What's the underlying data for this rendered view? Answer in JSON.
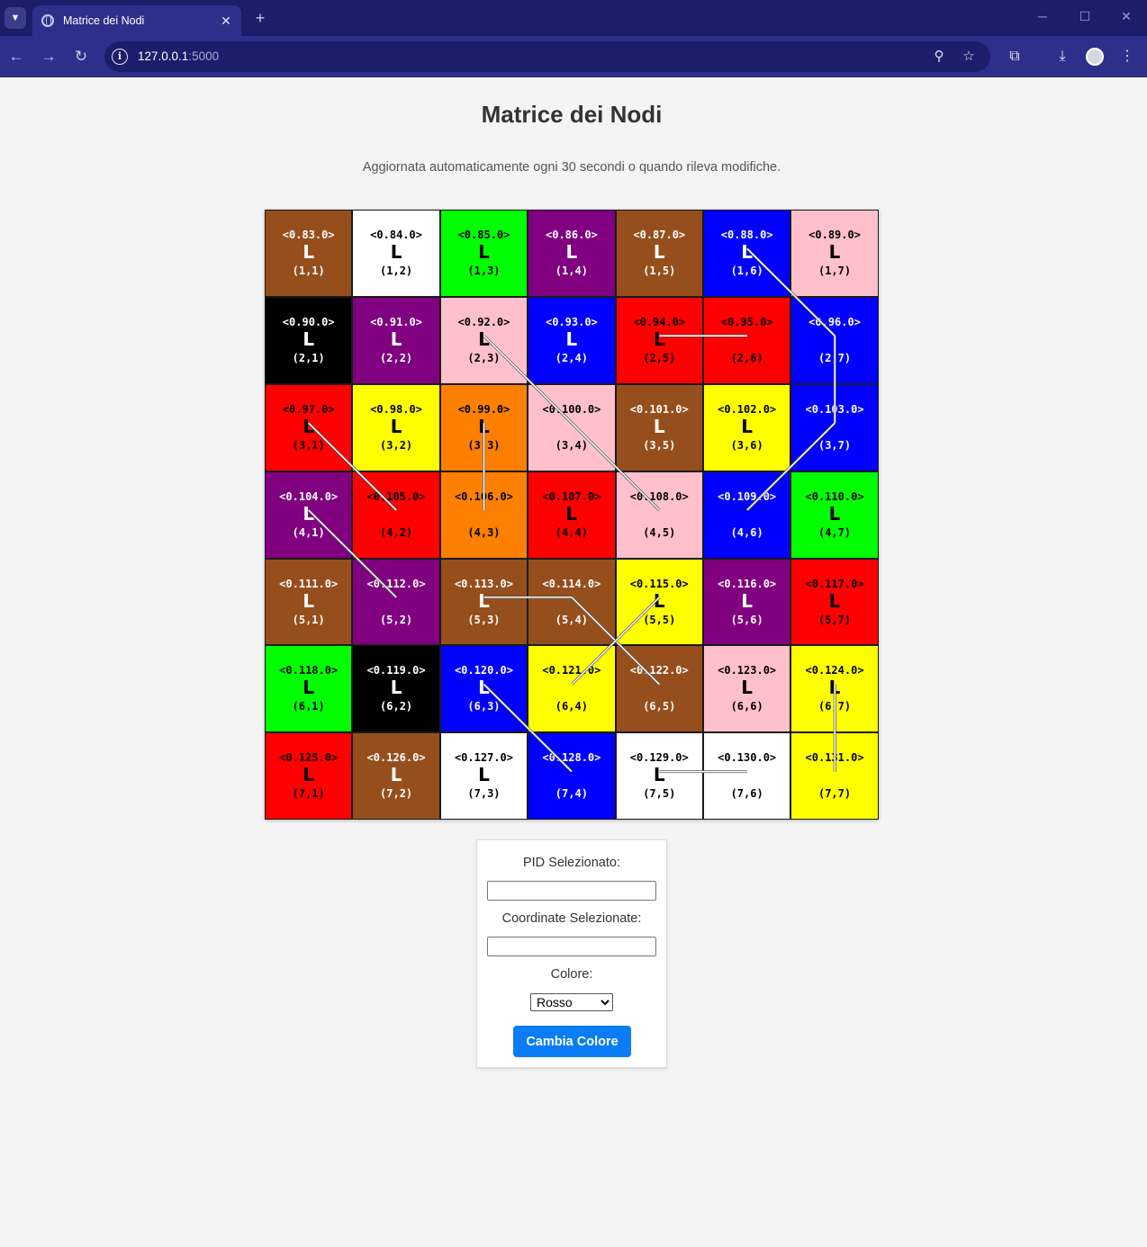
{
  "browser": {
    "tab_title": "Matrice dei Nodi",
    "url_host": "127.0.0.1",
    "url_port": ":5000"
  },
  "page": {
    "title": "Matrice dei Nodi",
    "subtitle": "Aggiornata automaticamente ogni 30 secondi o quando rileva modifiche."
  },
  "matrix": {
    "cells": [
      {
        "pid": "<0.83.0>",
        "letter": "L",
        "coord": "(1,1)",
        "color": "#964f1c",
        "text": "#ffffff"
      },
      {
        "pid": "<0.84.0>",
        "letter": "L",
        "coord": "(1,2)",
        "color": "#ffffff",
        "text": "#000000"
      },
      {
        "pid": "<0.85.0>",
        "letter": "L",
        "coord": "(1,3)",
        "color": "#00ff00",
        "text": "#000000"
      },
      {
        "pid": "<0.86.0>",
        "letter": "L",
        "coord": "(1,4)",
        "color": "#800080",
        "text": "#ffffff"
      },
      {
        "pid": "<0.87.0>",
        "letter": "L",
        "coord": "(1,5)",
        "color": "#964f1c",
        "text": "#ffffff"
      },
      {
        "pid": "<0.88.0>",
        "letter": "L",
        "coord": "(1,6)",
        "color": "#0000ff",
        "text": "#ffffff"
      },
      {
        "pid": "<0.89.0>",
        "letter": "L",
        "coord": "(1,7)",
        "color": "#ffc0cb",
        "text": "#000000"
      },
      {
        "pid": "<0.90.0>",
        "letter": "L",
        "coord": "(2,1)",
        "color": "#000000",
        "text": "#ffffff"
      },
      {
        "pid": "<0.91.0>",
        "letter": "L",
        "coord": "(2,2)",
        "color": "#800080",
        "text": "#ffffff"
      },
      {
        "pid": "<0.92.0>",
        "letter": "L",
        "coord": "(2,3)",
        "color": "#ffc0cb",
        "text": "#000000"
      },
      {
        "pid": "<0.93.0>",
        "letter": "L",
        "coord": "(2,4)",
        "color": "#0000ff",
        "text": "#ffffff"
      },
      {
        "pid": "<0.94.0>",
        "letter": "L",
        "coord": "(2,5)",
        "color": "#ff0000",
        "text": "#000000"
      },
      {
        "pid": "<0.95.0>",
        "letter": "",
        "coord": "(2,6)",
        "color": "#ff0000",
        "text": "#000000"
      },
      {
        "pid": "<0.96.0>",
        "letter": "",
        "coord": "(2,7)",
        "color": "#0000ff",
        "text": "#ffffff"
      },
      {
        "pid": "<0.97.0>",
        "letter": "L",
        "coord": "(3,1)",
        "color": "#ff0000",
        "text": "#000000"
      },
      {
        "pid": "<0.98.0>",
        "letter": "L",
        "coord": "(3,2)",
        "color": "#ffff00",
        "text": "#000000"
      },
      {
        "pid": "<0.99.0>",
        "letter": "L",
        "coord": "(3,3)",
        "color": "#ff8000",
        "text": "#000000"
      },
      {
        "pid": "<0.100.0>",
        "letter": "",
        "coord": "(3,4)",
        "color": "#ffc0cb",
        "text": "#000000"
      },
      {
        "pid": "<0.101.0>",
        "letter": "L",
        "coord": "(3,5)",
        "color": "#964f1c",
        "text": "#ffffff"
      },
      {
        "pid": "<0.102.0>",
        "letter": "L",
        "coord": "(3,6)",
        "color": "#ffff00",
        "text": "#000000"
      },
      {
        "pid": "<0.103.0>",
        "letter": "",
        "coord": "(3,7)",
        "color": "#0000ff",
        "text": "#ffffff"
      },
      {
        "pid": "<0.104.0>",
        "letter": "L",
        "coord": "(4,1)",
        "color": "#800080",
        "text": "#ffffff"
      },
      {
        "pid": "<0.105.0>",
        "letter": "",
        "coord": "(4,2)",
        "color": "#ff0000",
        "text": "#000000"
      },
      {
        "pid": "<0.106.0>",
        "letter": "",
        "coord": "(4,3)",
        "color": "#ff8000",
        "text": "#000000"
      },
      {
        "pid": "<0.107.0>",
        "letter": "L",
        "coord": "(4,4)",
        "color": "#ff0000",
        "text": "#000000"
      },
      {
        "pid": "<0.108.0>",
        "letter": "",
        "coord": "(4,5)",
        "color": "#ffc0cb",
        "text": "#000000"
      },
      {
        "pid": "<0.109.0>",
        "letter": "",
        "coord": "(4,6)",
        "color": "#0000ff",
        "text": "#ffffff"
      },
      {
        "pid": "<0.110.0>",
        "letter": "L",
        "coord": "(4,7)",
        "color": "#00ff00",
        "text": "#000000"
      },
      {
        "pid": "<0.111.0>",
        "letter": "L",
        "coord": "(5,1)",
        "color": "#964f1c",
        "text": "#ffffff"
      },
      {
        "pid": "<0.112.0>",
        "letter": "",
        "coord": "(5,2)",
        "color": "#800080",
        "text": "#ffffff"
      },
      {
        "pid": "<0.113.0>",
        "letter": "L",
        "coord": "(5,3)",
        "color": "#964f1c",
        "text": "#ffffff"
      },
      {
        "pid": "<0.114.0>",
        "letter": "",
        "coord": "(5,4)",
        "color": "#964f1c",
        "text": "#ffffff"
      },
      {
        "pid": "<0.115.0>",
        "letter": "L",
        "coord": "(5,5)",
        "color": "#ffff00",
        "text": "#000000"
      },
      {
        "pid": "<0.116.0>",
        "letter": "L",
        "coord": "(5,6)",
        "color": "#800080",
        "text": "#ffffff"
      },
      {
        "pid": "<0.117.0>",
        "letter": "L",
        "coord": "(5,7)",
        "color": "#ff0000",
        "text": "#000000"
      },
      {
        "pid": "<0.118.0>",
        "letter": "L",
        "coord": "(6,1)",
        "color": "#00ff00",
        "text": "#000000"
      },
      {
        "pid": "<0.119.0>",
        "letter": "L",
        "coord": "(6,2)",
        "color": "#000000",
        "text": "#ffffff"
      },
      {
        "pid": "<0.120.0>",
        "letter": "L",
        "coord": "(6,3)",
        "color": "#0000ff",
        "text": "#ffffff"
      },
      {
        "pid": "<0.121.0>",
        "letter": "",
        "coord": "(6,4)",
        "color": "#ffff00",
        "text": "#000000"
      },
      {
        "pid": "<0.122.0>",
        "letter": "",
        "coord": "(6,5)",
        "color": "#964f1c",
        "text": "#ffffff"
      },
      {
        "pid": "<0.123.0>",
        "letter": "L",
        "coord": "(6,6)",
        "color": "#ffc0cb",
        "text": "#000000"
      },
      {
        "pid": "<0.124.0>",
        "letter": "L",
        "coord": "(6,7)",
        "color": "#ffff00",
        "text": "#000000"
      },
      {
        "pid": "<0.125.0>",
        "letter": "L",
        "coord": "(7,1)",
        "color": "#ff0000",
        "text": "#000000"
      },
      {
        "pid": "<0.126.0>",
        "letter": "L",
        "coord": "(7,2)",
        "color": "#964f1c",
        "text": "#ffffff"
      },
      {
        "pid": "<0.127.0>",
        "letter": "L",
        "coord": "(7,3)",
        "color": "#ffffff",
        "text": "#000000"
      },
      {
        "pid": "<0.128.0>",
        "letter": "",
        "coord": "(7,4)",
        "color": "#0000ff",
        "text": "#ffffff"
      },
      {
        "pid": "<0.129.0>",
        "letter": "L",
        "coord": "(7,5)",
        "color": "#ffffff",
        "text": "#000000"
      },
      {
        "pid": "<0.130.0>",
        "letter": "",
        "coord": "(7,6)",
        "color": "#ffffff",
        "text": "#000000"
      },
      {
        "pid": "<0.131.0>",
        "letter": "",
        "coord": "(7,7)",
        "color": "#ffff00",
        "text": "#000000"
      }
    ],
    "links": [
      {
        "from": [
          1,
          6
        ],
        "to": [
          2,
          7
        ]
      },
      {
        "from": [
          2,
          7
        ],
        "to": [
          3,
          7
        ]
      },
      {
        "from": [
          3,
          7
        ],
        "to": [
          4,
          6
        ]
      },
      {
        "from": [
          2,
          5
        ],
        "to": [
          2,
          6
        ]
      },
      {
        "from": [
          2,
          3
        ],
        "to": [
          3,
          4
        ]
      },
      {
        "from": [
          3,
          4
        ],
        "to": [
          4,
          5
        ]
      },
      {
        "from": [
          3,
          1
        ],
        "to": [
          4,
          2
        ]
      },
      {
        "from": [
          3,
          3
        ],
        "to": [
          4,
          3
        ]
      },
      {
        "from": [
          4,
          1
        ],
        "to": [
          5,
          2
        ]
      },
      {
        "from": [
          5,
          3
        ],
        "to": [
          5,
          4
        ]
      },
      {
        "from": [
          5,
          4
        ],
        "to": [
          6,
          5
        ]
      },
      {
        "from": [
          5,
          5
        ],
        "to": [
          6,
          4
        ]
      },
      {
        "from": [
          6,
          3
        ],
        "to": [
          7,
          4
        ]
      },
      {
        "from": [
          6,
          7
        ],
        "to": [
          7,
          7
        ]
      },
      {
        "from": [
          7,
          5
        ],
        "to": [
          7,
          6
        ]
      }
    ]
  },
  "panel": {
    "pid_label": "PID Selezionato:",
    "pid_value": "",
    "coord_label": "Coordinate Selezionate:",
    "coord_value": "",
    "color_label": "Colore:",
    "color_selected": "Rosso",
    "submit_label": "Cambia Colore"
  }
}
